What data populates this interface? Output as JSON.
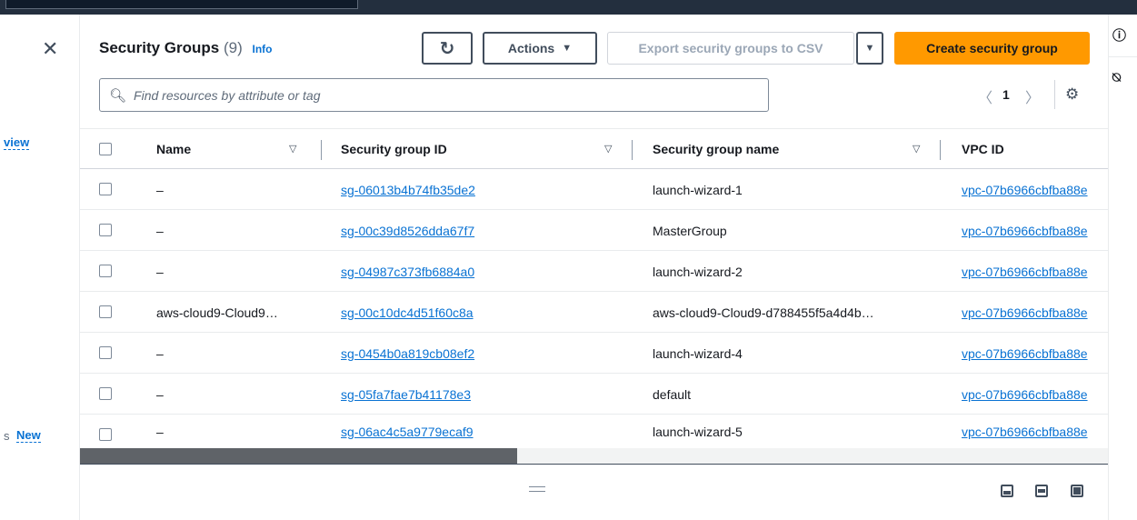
{
  "left_nav": {
    "link_view": "view",
    "frag_s": "s",
    "link_new": "New"
  },
  "header": {
    "title": "Security Groups",
    "count": "(9)",
    "info": "Info",
    "actions_label": "Actions",
    "export_label": "Export security groups to CSV",
    "create_label": "Create security group"
  },
  "search": {
    "placeholder": "Find resources by attribute or tag"
  },
  "pagination": {
    "current_page": "1"
  },
  "table": {
    "columns": [
      "Name",
      "Security group ID",
      "Security group name",
      "VPC ID"
    ],
    "rows": [
      {
        "name": "–",
        "id": "sg-06013b4b74fb35de2",
        "group_name": "launch-wizard-1",
        "vpc": "vpc-07b6966cbfba88e"
      },
      {
        "name": "–",
        "id": "sg-00c39d8526dda67f7",
        "group_name": "MasterGroup",
        "vpc": "vpc-07b6966cbfba88e"
      },
      {
        "name": "–",
        "id": "sg-04987c373fb6884a0",
        "group_name": "launch-wizard-2",
        "vpc": "vpc-07b6966cbfba88e"
      },
      {
        "name": "aws-cloud9-Cloud9…",
        "id": "sg-00c10dc4d51f60c8a",
        "group_name": "aws-cloud9-Cloud9-d788455f5a4d4b…",
        "vpc": "vpc-07b6966cbfba88e"
      },
      {
        "name": "–",
        "id": "sg-0454b0a819cb08ef2",
        "group_name": "launch-wizard-4",
        "vpc": "vpc-07b6966cbfba88e"
      },
      {
        "name": "–",
        "id": "sg-05fa7fae7b41178e3",
        "group_name": "default",
        "vpc": "vpc-07b6966cbfba88e"
      },
      {
        "name": "–",
        "id": "sg-06ac4c5a9779ecaf9",
        "group_name": "launch-wizard-5",
        "vpc": "vpc-07b6966cbfba88e"
      }
    ]
  },
  "colors": {
    "accent": "#0972d3",
    "primary_button": "#ff9900",
    "top_bar": "#232f3e"
  },
  "icons": {
    "close": "close-icon",
    "refresh": "refresh-icon",
    "search": "search-icon",
    "settings": "gear-icon",
    "info_rail": "info-icon",
    "feedback_rail": "feedback-icon"
  }
}
